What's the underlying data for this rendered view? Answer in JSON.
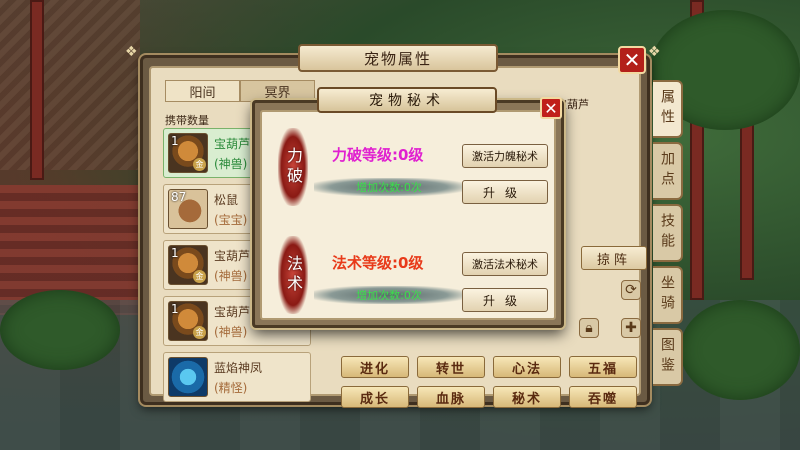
{
  "main_panel": {
    "title": "宠物属性",
    "close_label": "✕",
    "realm_tabs": [
      "阳间",
      "冥界"
    ],
    "carry_label": "携带数量",
    "right_pet_name": "宝葫芦",
    "formation_button": "掠阵",
    "side_tabs": [
      "属性",
      "加点",
      "技能",
      "坐骑",
      "图鉴"
    ],
    "actions": [
      "进化",
      "转世",
      "心法",
      "五福",
      "成长",
      "血脉",
      "秘术",
      "吞噬"
    ]
  },
  "pets": [
    {
      "level": "1",
      "name": "宝葫芦",
      "type": "(神兽)",
      "tag": "金"
    },
    {
      "level": "87",
      "name": "松鼠",
      "type": "(宝宝)",
      "tag": ""
    },
    {
      "level": "1",
      "name": "宝葫芦",
      "type": "(神兽)",
      "tag": "金"
    },
    {
      "level": "1",
      "name": "宝葫芦",
      "type": "(神兽)",
      "tag": "金"
    },
    {
      "level": "",
      "name": "蓝焰神凤",
      "type": "(精怪)",
      "tag": ""
    }
  ],
  "modal": {
    "title": "宠物秘术",
    "close_label": "✕",
    "skills": [
      {
        "emblem": "力破",
        "level_text": "力破等级:0级",
        "level_color": "#e020d0",
        "add_text": "增加次数:0次",
        "activate_label": "激活力魄秘术",
        "upgrade_label": "升级"
      },
      {
        "emblem": "法术",
        "level_text": "法术等级:0级",
        "level_color": "#e83a1a",
        "add_text": "增加次数:0次",
        "activate_label": "激活法术秘术",
        "upgrade_label": "升级"
      }
    ]
  }
}
